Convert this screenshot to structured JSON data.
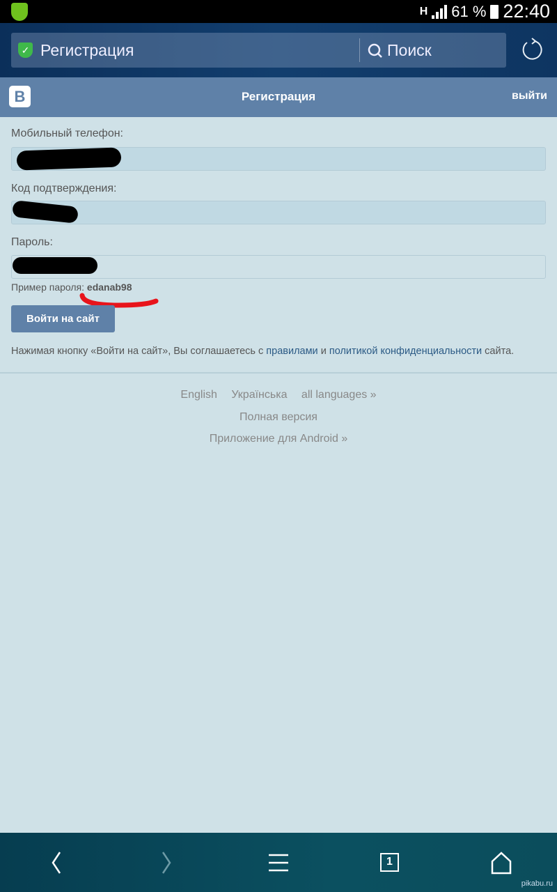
{
  "status_bar": {
    "network": "H",
    "battery": "61 %",
    "time": "22:40"
  },
  "browser": {
    "url_title": "Регистрация",
    "search_label": "Поиск"
  },
  "header": {
    "logo": "В",
    "title": "Регистрация",
    "logout": "выйти"
  },
  "form": {
    "phone_label": "Мобильный телефон:",
    "code_label": "Код подтверждения:",
    "password_label": "Пароль:",
    "password_hint": "Пример пароля:",
    "password_example": "edanab98",
    "submit": "Войти на сайт"
  },
  "terms": {
    "before": "Нажимая кнопку «Войти на сайт», Вы соглашаетесь с",
    "rules": "правилами",
    "and": "и",
    "privacy": "политикой конфиденциальности",
    "after": "сайта."
  },
  "footer": {
    "languages": [
      "English",
      "Українська",
      "all languages »"
    ],
    "full_version": "Полная версия",
    "android_app": "Приложение для Android »"
  },
  "bottom_nav": {
    "tabs_count": "1"
  },
  "watermark": "pikabu.ru",
  "colors": {
    "vk_blue": "#5f81a8",
    "background": "#cfe1e7",
    "link": "#2b5a85",
    "annotation": "#e8141b"
  }
}
